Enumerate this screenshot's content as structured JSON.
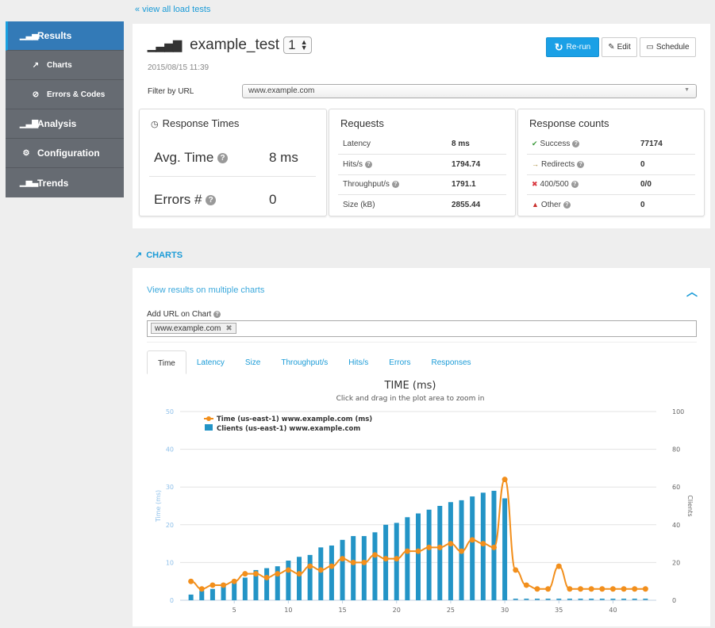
{
  "nav": {
    "back_link": "« view all load tests"
  },
  "sidebar": {
    "items": [
      {
        "label": "Results",
        "icon": "bar-chart-icon",
        "glyph": "▁▃▅",
        "active": true,
        "sub": false
      },
      {
        "label": "Charts",
        "icon": "line-chart-icon",
        "glyph": "↗",
        "active": false,
        "sub": true
      },
      {
        "label": "Errors & Codes",
        "icon": "check-circle-icon",
        "glyph": "⊘",
        "active": false,
        "sub": true
      },
      {
        "label": "Analysis",
        "icon": "signal-icon",
        "glyph": "▁▃▇",
        "active": false,
        "sub": false
      },
      {
        "label": "Configuration",
        "icon": "gears-icon",
        "glyph": "⚙",
        "active": false,
        "sub": false
      },
      {
        "label": "Trends",
        "icon": "bar-chart-icon",
        "glyph": "▁▅▃",
        "active": false,
        "sub": false
      }
    ]
  },
  "header": {
    "title": "example_test",
    "run_number": "1",
    "date": "2015/08/15 11:39",
    "buttons": {
      "rerun": "Re-run",
      "edit": "Edit",
      "schedule": "Schedule"
    },
    "filter_label": "Filter by URL",
    "filter_value": "www.example.com"
  },
  "response_times": {
    "title": "Response Times",
    "avg_label": "Avg. Time",
    "avg_value": "8 ms",
    "errors_label": "Errors #",
    "errors_value": "0"
  },
  "requests": {
    "title": "Requests",
    "rows": [
      {
        "label": "Latency",
        "value": "8 ms",
        "help": false
      },
      {
        "label": "Hits/s",
        "value": "1794.74",
        "help": true
      },
      {
        "label": "Throughput/s",
        "value": "1791.1",
        "help": true
      },
      {
        "label": "Size (kB)",
        "value": "2855.44",
        "help": false
      }
    ]
  },
  "response_counts": {
    "title": "Response counts",
    "rows": [
      {
        "label": "Success",
        "value": "77174",
        "icon": "success-icon",
        "color": "#3c9a3c",
        "glyph": "✔"
      },
      {
        "label": "Redirects",
        "value": "0",
        "icon": "redirect-icon",
        "color": "#a88a3a",
        "glyph": "→"
      },
      {
        "label": "400/500",
        "value": "0/0",
        "icon": "error-icon",
        "color": "#d9363e",
        "glyph": "✖"
      },
      {
        "label": "Other",
        "value": "0",
        "icon": "warning-icon",
        "color": "#c9302c",
        "glyph": "▲"
      }
    ]
  },
  "charts_section": {
    "heading": "CHARTS",
    "multi_link": "View results on multiple charts",
    "add_url_label": "Add URL on Chart",
    "tag": "www.example.com",
    "tabs": [
      "Time",
      "Latency",
      "Size",
      "Throughput/s",
      "Hits/s",
      "Errors",
      "Responses"
    ],
    "active_tab": "Time"
  },
  "colors": {
    "accent": "#1a9bd7",
    "time_series": "#f28f1c",
    "clients_series": "#2394c6"
  },
  "chart_data": {
    "type": "bar+line",
    "title": "TIME (ms)",
    "subtitle": "Click and drag in the plot area to zoom in",
    "ylabel": "Time (ms)",
    "y2label": "Clients",
    "ylim": [
      0,
      50
    ],
    "y2lim": [
      0,
      100
    ],
    "yticks": [
      0,
      10,
      20,
      30,
      40,
      50
    ],
    "y2ticks": [
      0,
      20,
      40,
      60,
      80,
      100
    ],
    "xticks": [
      5,
      10,
      15,
      20,
      25,
      30,
      35,
      40
    ],
    "xlim": [
      0,
      44
    ],
    "grid": true,
    "legend_position": "top-left",
    "x": [
      1,
      2,
      3,
      4,
      5,
      6,
      7,
      8,
      9,
      10,
      11,
      12,
      13,
      14,
      15,
      16,
      17,
      18,
      19,
      20,
      21,
      22,
      23,
      24,
      25,
      26,
      27,
      28,
      29,
      30,
      31,
      32,
      33,
      34,
      35,
      36,
      37,
      38,
      39,
      40,
      41,
      42,
      43
    ],
    "series": [
      {
        "name": "Time (us-east-1) www.example.com (ms)",
        "type": "line",
        "axis": "left",
        "values": [
          5,
          3,
          4,
          4,
          5,
          7,
          7,
          6,
          7,
          8,
          7,
          9,
          8,
          9,
          11,
          10,
          10,
          12,
          11,
          11,
          13,
          13,
          14,
          14,
          15,
          13,
          16,
          15,
          14,
          32,
          8,
          4,
          3,
          3,
          9,
          3,
          3,
          3,
          3,
          3,
          3,
          3,
          3
        ]
      },
      {
        "name": "Clients (us-east-1) www.example.com",
        "type": "bar",
        "axis": "right",
        "values": [
          3,
          5,
          6,
          9,
          10,
          12,
          16,
          17,
          18,
          21,
          23,
          24,
          28,
          29,
          32,
          34,
          34,
          36,
          40,
          41,
          44,
          46,
          48,
          50,
          52,
          53,
          55,
          57,
          58,
          54,
          0.5,
          0.5,
          0.5,
          0.5,
          0.5,
          0.5,
          0.5,
          0.5,
          0.5,
          0.5,
          0.5,
          0.5,
          0.5
        ]
      }
    ]
  }
}
